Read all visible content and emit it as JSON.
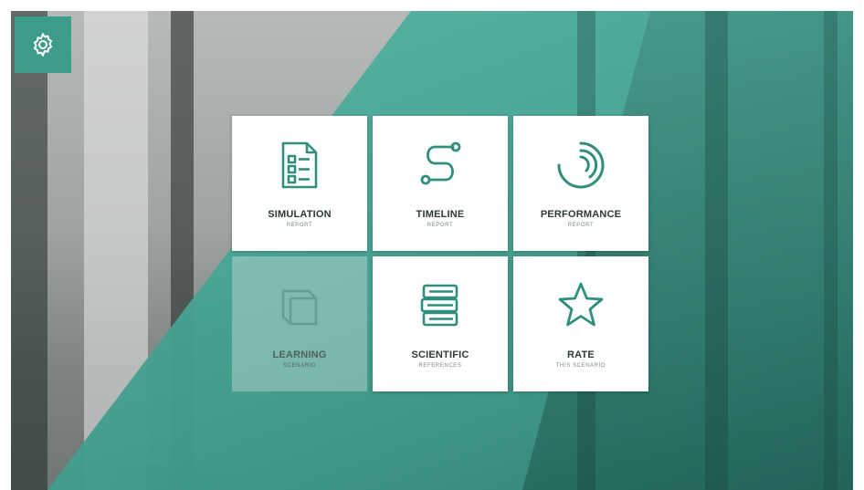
{
  "colors": {
    "accent": "#3d9d8a",
    "icon_stroke": "#2f8f7c",
    "tile_bg": "#ffffff"
  },
  "settings": {
    "icon": "gear-icon"
  },
  "tiles": [
    {
      "title": "SIMULATION",
      "subtitle": "REPORT",
      "icon": "document-checklist-icon",
      "faded": false
    },
    {
      "title": "TIMELINE",
      "subtitle": "REPORT",
      "icon": "timeline-path-icon",
      "faded": false
    },
    {
      "title": "PERFORMANCE",
      "subtitle": "REPORT",
      "icon": "arcs-gauge-icon",
      "faded": false
    },
    {
      "title": "LEARNING",
      "subtitle": "SCENARIO",
      "icon": "book-icon",
      "faded": true
    },
    {
      "title": "SCIENTIFIC",
      "subtitle": "REFERENCES",
      "icon": "books-stack-icon",
      "faded": false
    },
    {
      "title": "RATE",
      "subtitle": "THIS SCENARIO",
      "icon": "star-icon",
      "faded": false
    }
  ]
}
